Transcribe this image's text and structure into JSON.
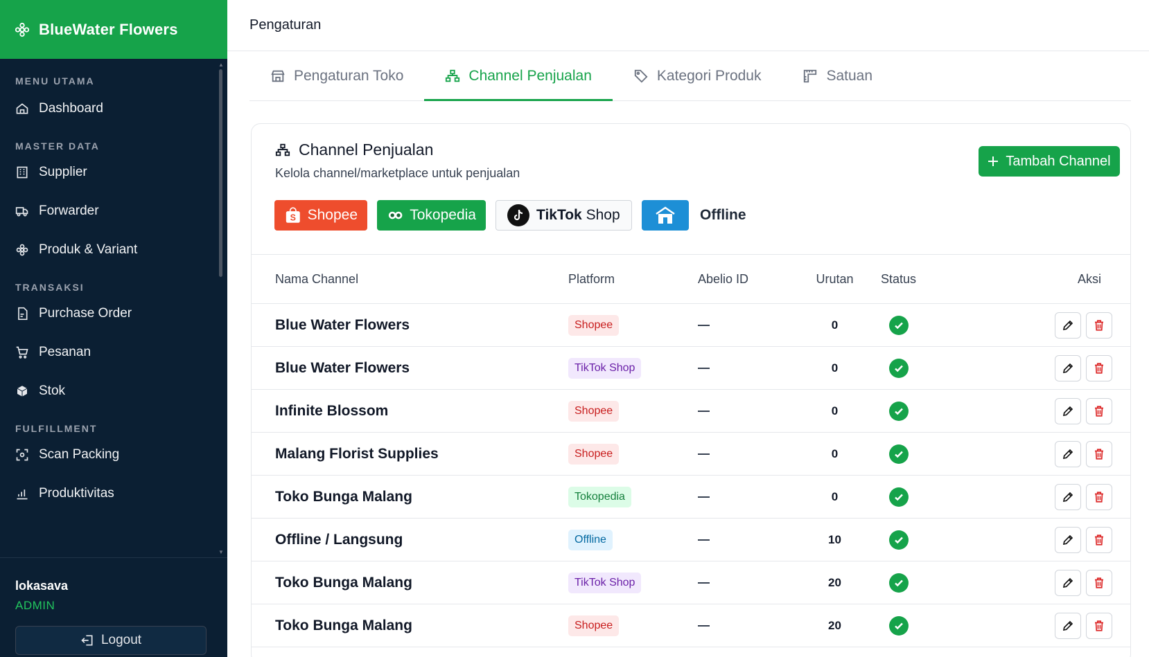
{
  "brand": {
    "title": "BlueWater Flowers"
  },
  "sidebar": {
    "sections": [
      {
        "title": "MENU UTAMA",
        "items": [
          {
            "label": "Dashboard",
            "icon": "dashboard-icon"
          }
        ]
      },
      {
        "title": "MASTER DATA",
        "items": [
          {
            "label": "Supplier",
            "icon": "building-icon"
          },
          {
            "label": "Forwarder",
            "icon": "truck-icon"
          },
          {
            "label": "Produk & Variant",
            "icon": "flower-icon"
          }
        ]
      },
      {
        "title": "TRANSAKSI",
        "items": [
          {
            "label": "Purchase Order",
            "icon": "document-icon"
          },
          {
            "label": "Pesanan",
            "icon": "cart-icon"
          },
          {
            "label": "Stok",
            "icon": "boxes-icon"
          }
        ]
      },
      {
        "title": "FULFILLMENT",
        "items": [
          {
            "label": "Scan Packing",
            "icon": "scan-icon"
          },
          {
            "label": "Produktivitas",
            "icon": "chart-icon"
          }
        ]
      }
    ]
  },
  "user": {
    "name": "lokasava",
    "role": "ADMIN",
    "logout_label": "Logout"
  },
  "header": {
    "title": "Pengaturan"
  },
  "tabs": [
    {
      "label": "Pengaturan Toko",
      "icon": "shop-icon",
      "active": false
    },
    {
      "label": "Channel Penjualan",
      "icon": "channel-icon",
      "active": true
    },
    {
      "label": "Kategori Produk",
      "icon": "tag-icon",
      "active": false
    },
    {
      "label": "Satuan",
      "icon": "ruler-icon",
      "active": false
    }
  ],
  "card": {
    "title": "Channel Penjualan",
    "subtitle": "Kelola channel/marketplace untuk penjualan",
    "add_label": "Tambah Channel"
  },
  "platforms": {
    "shopee": "Shopee",
    "tokopedia": "Tokopedia",
    "tiktok_bold": "TikTok",
    "tiktok_rest": "Shop",
    "offline": "Offline"
  },
  "table": {
    "headers": {
      "name": "Nama Channel",
      "platform": "Platform",
      "abelio": "Abelio ID",
      "order": "Urutan",
      "status": "Status",
      "actions": "Aksi"
    },
    "rows": [
      {
        "name": "Blue Water Flowers",
        "platform": "Shopee",
        "type": "shopee",
        "order": "0"
      },
      {
        "name": "Blue Water Flowers",
        "platform": "TikTok Shop",
        "type": "tiktok",
        "order": "0"
      },
      {
        "name": "Infinite Blossom",
        "platform": "Shopee",
        "type": "shopee",
        "order": "0"
      },
      {
        "name": "Malang Florist Supplies",
        "platform": "Shopee",
        "type": "shopee",
        "order": "0"
      },
      {
        "name": "Toko Bunga Malang",
        "platform": "Tokopedia",
        "type": "tokopedia",
        "order": "0"
      },
      {
        "name": "Offline / Langsung",
        "platform": "Offline",
        "type": "offline",
        "order": "10"
      },
      {
        "name": "Toko Bunga Malang",
        "platform": "TikTok Shop",
        "type": "tiktok",
        "order": "20"
      },
      {
        "name": "Toko Bunga Malang",
        "platform": "Shopee",
        "type": "shopee",
        "order": "20"
      }
    ]
  },
  "colors": {
    "brand": "#16a34a",
    "sidebar": "#0b1f33",
    "danger": "#dc2626",
    "shopee": "#ee4d2d",
    "offline": "#1d8fd6"
  }
}
